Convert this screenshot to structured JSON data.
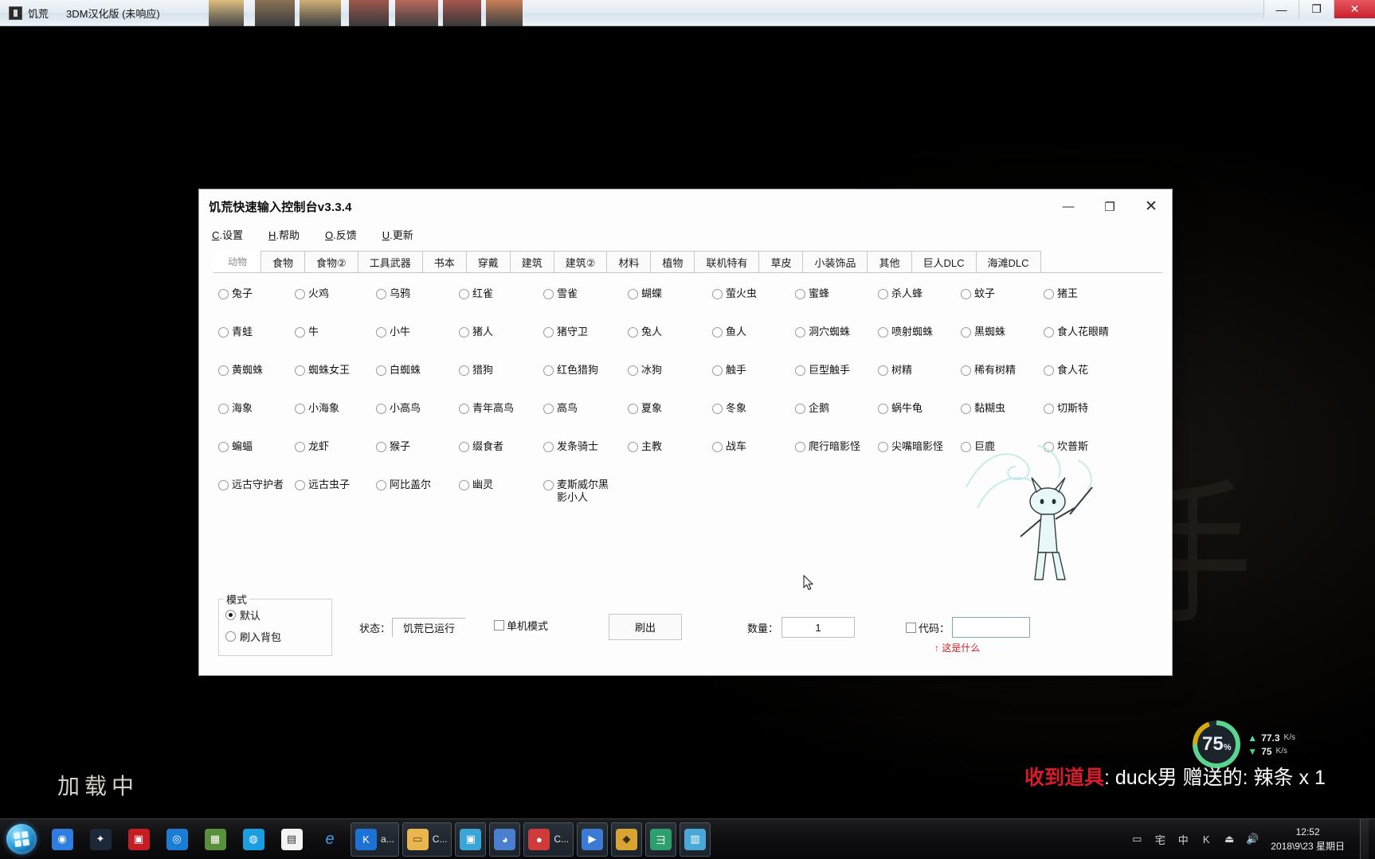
{
  "game_window": {
    "icon": "book-icon",
    "title": "饥荒",
    "subtitle": "3DM汉化版 (未响应)",
    "buttons": {
      "minimize": "—",
      "maximize": "❐",
      "close": "✕"
    },
    "loading_text": "加载中",
    "bg_art_text": "三手"
  },
  "overlay": {
    "net": {
      "percent": "75",
      "percent_unit": "%",
      "upload": "77.3",
      "upload_unit": "K/s",
      "download": "75",
      "download_unit": "K/s",
      "up_arrow": "▲",
      "down_arrow": "▼"
    },
    "gift": {
      "prefix": "收到道具",
      "body": ": duck男 赠送的: 辣条 x 1"
    }
  },
  "tool_window": {
    "title": "饥荒快速输入控制台v3.3.4",
    "window_buttons": {
      "minimize": "—",
      "maximize": "❐",
      "close": "✕"
    },
    "menu": [
      {
        "accel": "C",
        "label": ".设置"
      },
      {
        "accel": "H",
        "label": ".帮助"
      },
      {
        "accel": "O",
        "label": ".反馈"
      },
      {
        "accel": "U",
        "label": ".更新"
      }
    ],
    "tabs": [
      {
        "label": "动物",
        "active": true
      },
      {
        "label": "食物",
        "active": false
      },
      {
        "label": "食物②",
        "active": false
      },
      {
        "label": "工具武器",
        "active": false
      },
      {
        "label": "书本",
        "active": false
      },
      {
        "label": "穿戴",
        "active": false
      },
      {
        "label": "建筑",
        "active": false
      },
      {
        "label": "建筑②",
        "active": false
      },
      {
        "label": "材料",
        "active": false
      },
      {
        "label": "植物",
        "active": false
      },
      {
        "label": "联机特有",
        "active": false
      },
      {
        "label": "草皮",
        "active": false
      },
      {
        "label": "小装饰品",
        "active": false
      },
      {
        "label": "其他",
        "active": false
      },
      {
        "label": "巨人DLC",
        "active": false
      },
      {
        "label": "海滩DLC",
        "active": false
      }
    ],
    "animal_rows": [
      [
        "兔子",
        "火鸡",
        "乌鸦",
        "红雀",
        "雪雀",
        "蝴蝶",
        "萤火虫",
        "蜜蜂",
        "杀人蜂",
        "蚊子",
        "猪王"
      ],
      [
        "青蛙",
        "牛",
        "小牛",
        "猪人",
        "猪守卫",
        "兔人",
        "鱼人",
        "洞穴蜘蛛",
        "喷射蜘蛛",
        "黑蜘蛛",
        "食人花眼睛"
      ],
      [
        "黄蜘蛛",
        "蜘蛛女王",
        "白蜘蛛",
        "猎狗",
        "红色猎狗",
        "冰狗",
        "触手",
        "巨型触手",
        "树精",
        "稀有树精",
        "食人花"
      ],
      [
        "海象",
        "小海象",
        "小高鸟",
        "青年高鸟",
        "高鸟",
        "夏象",
        "冬象",
        "企鹅",
        "蜗牛龟",
        "黏糊虫",
        "切斯特"
      ],
      [
        "蝙蝠",
        "龙虾",
        "猴子",
        "缀食者",
        "发条骑士",
        "主教",
        "战车",
        "爬行暗影怪",
        "尖嘴暗影怪",
        "巨鹿",
        "坎普斯"
      ],
      [
        "远古守护者",
        "远古虫子",
        "阿比盖尔",
        "幽灵",
        "麦斯威尔黑影小人"
      ]
    ],
    "bottom": {
      "mode_legend": "模式",
      "mode_options": [
        {
          "label": "默认",
          "selected": true
        },
        {
          "label": "刷入背包",
          "selected": false
        }
      ],
      "status_label": "状态：",
      "status_value": "饥荒已运行",
      "single_mode_label": "单机模式",
      "spawn_button": "刷出",
      "qty_label": "数量：",
      "qty_value": "1",
      "code_label": "代码：",
      "code_value": "",
      "code_hint": "↑ 这是什么"
    }
  },
  "taskbar": {
    "start_label": "start-orb",
    "items": [
      {
        "name": "chrome",
        "glyph": "◉",
        "color": "#2f7de0",
        "text": ""
      },
      {
        "name": "steam",
        "glyph": "✦",
        "color": "#1b2838",
        "text": ""
      },
      {
        "name": "browser-panda",
        "glyph": "▣",
        "color": "#c41e24",
        "text": ""
      },
      {
        "name": "qq-browser",
        "glyph": "◎",
        "color": "#1a7cd4",
        "text": ""
      },
      {
        "name": "minecraft",
        "glyph": "▦",
        "color": "#5a8f3c",
        "text": ""
      },
      {
        "name": "edge-legacy",
        "glyph": "◍",
        "color": "#1b9de2",
        "text": ""
      },
      {
        "name": "notepad",
        "glyph": "▤",
        "color": "#f4f4f4",
        "text": ""
      },
      {
        "name": "internet-explorer",
        "glyph": "e",
        "color": "#1b73c7",
        "text": ""
      },
      {
        "name": "kugou",
        "glyph": "K",
        "color": "#1e72d6",
        "text": "a..."
      },
      {
        "name": "file-explorer",
        "glyph": "▭",
        "color": "#e8b64c",
        "text": "C..."
      },
      {
        "name": "live-app",
        "glyph": "▣",
        "color": "#3aa6d8",
        "text": ""
      },
      {
        "name": "anime-app",
        "glyph": "◕",
        "color": "#4a7fd0",
        "text": ""
      },
      {
        "name": "obs-record",
        "glyph": "●",
        "color": "#cf3a3a",
        "text": "C..."
      },
      {
        "name": "video-editor",
        "glyph": "▶",
        "color": "#3b7bd4",
        "text": ""
      },
      {
        "name": "game-launcher",
        "glyph": "◆",
        "color": "#d8a534",
        "text": ""
      },
      {
        "name": "input-method",
        "glyph": "彐",
        "color": "#2e9e6c",
        "text": ""
      },
      {
        "name": "calculator-app",
        "glyph": "▥",
        "color": "#4aa8d8",
        "text": ""
      }
    ],
    "tray": [
      {
        "name": "tray-monitor-icon",
        "glyph": "▭"
      },
      {
        "name": "tray-input-icon",
        "glyph": "宅"
      },
      {
        "name": "tray-ime-icon",
        "glyph": "中"
      },
      {
        "name": "tray-keyboard-icon",
        "glyph": "K"
      },
      {
        "name": "tray-usb-icon",
        "glyph": "⏏"
      },
      {
        "name": "tray-volume-icon",
        "glyph": "🔊"
      }
    ],
    "clock_time": "12:52",
    "clock_date": "2018\\9\\23 星期日"
  }
}
